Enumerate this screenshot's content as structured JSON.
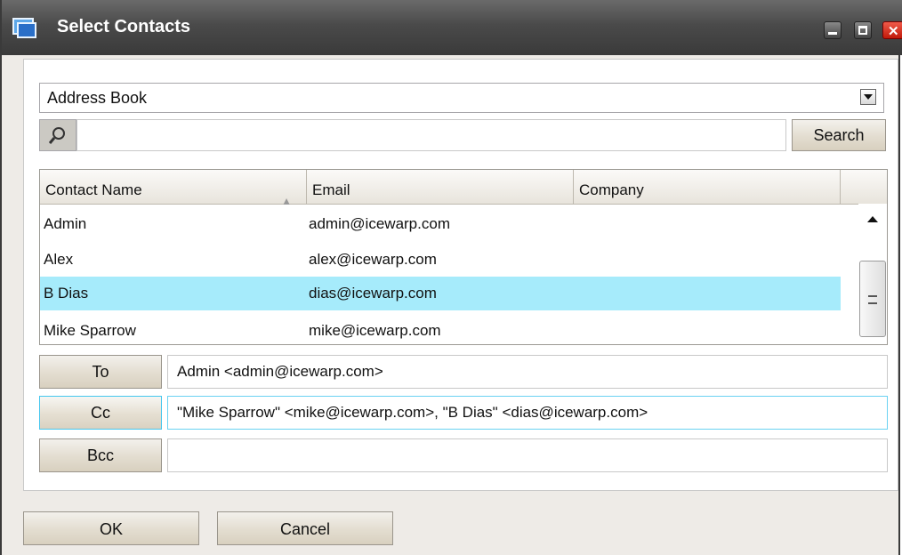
{
  "window": {
    "title": "Select Contacts"
  },
  "address_book": {
    "selected": "Address Book"
  },
  "search": {
    "value": "",
    "placeholder": "",
    "button_label": "Search"
  },
  "grid": {
    "columns": [
      "Contact Name",
      "Email",
      "Company"
    ],
    "rows": [
      {
        "name": "Admin",
        "email": "admin@icewarp.com",
        "company": "",
        "selected": false
      },
      {
        "name": "Alex",
        "email": "alex@icewarp.com",
        "company": "",
        "selected": false
      },
      {
        "name": "B Dias",
        "email": "dias@icewarp.com",
        "company": "",
        "selected": true
      },
      {
        "name": "Mike Sparrow",
        "email": "mike@icewarp.com",
        "company": "",
        "selected": false
      }
    ]
  },
  "recipients": {
    "to": {
      "label": "To",
      "value": "Admin <admin@icewarp.com>"
    },
    "cc": {
      "label": "Cc",
      "value": "\"Mike Sparrow\" <mike@icewarp.com>, \"B Dias\" <dias@icewarp.com>"
    },
    "bcc": {
      "label": "Bcc",
      "value": ""
    }
  },
  "footer": {
    "ok_label": "OK",
    "cancel_label": "Cancel"
  },
  "colors": {
    "selection": "#a6ebfb",
    "active_border": "#45c7ee",
    "titlebar": "#4a4a4a"
  }
}
